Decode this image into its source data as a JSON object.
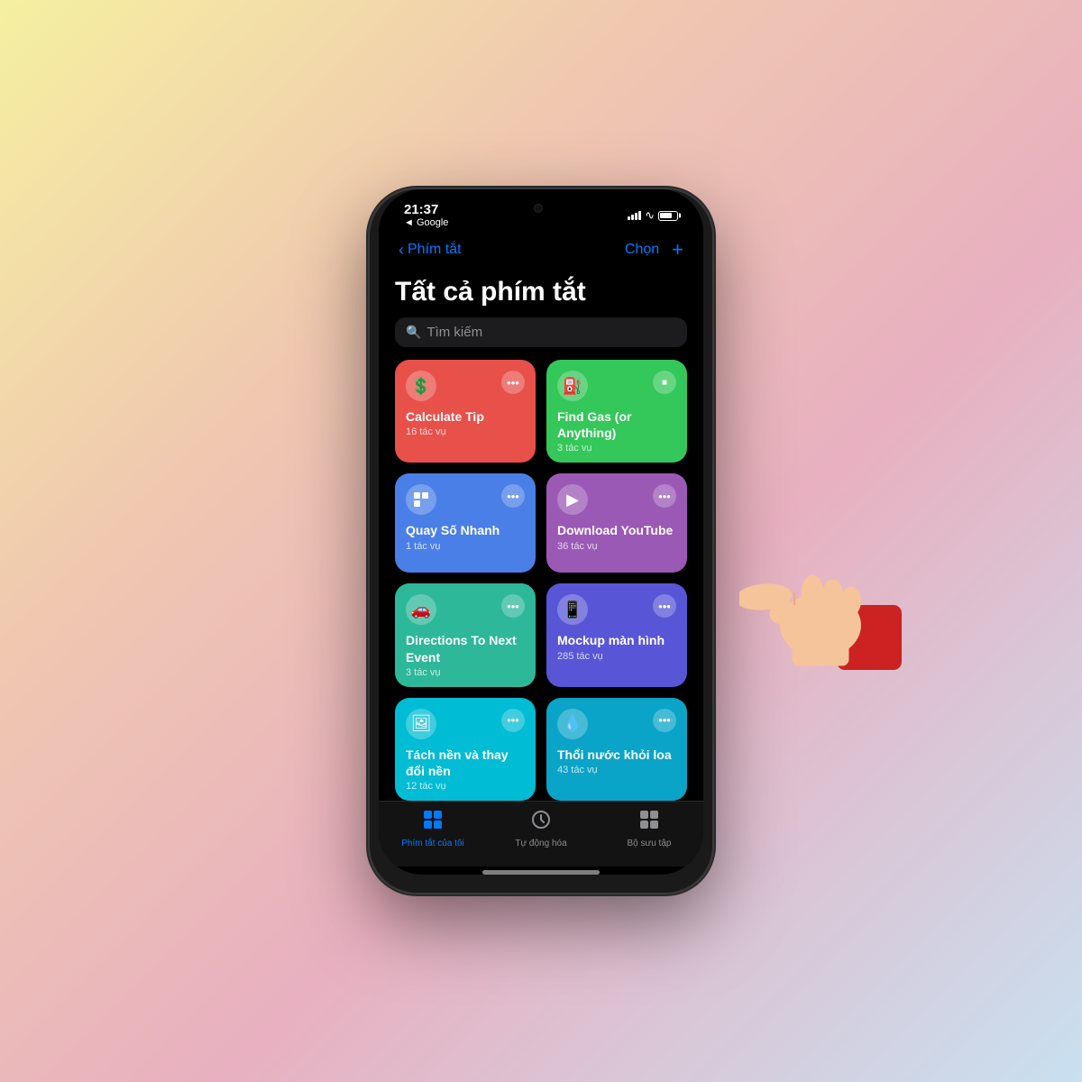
{
  "background": {
    "gradient": "linear-gradient(135deg, #f5f0a0, #f0c8b0, #e8b0c0, #c8e0f0)"
  },
  "status_bar": {
    "time": "21:37",
    "back_label": "◄ Google"
  },
  "nav": {
    "back_text": "Phím tắt",
    "choose_label": "Chọn",
    "add_label": "+"
  },
  "page": {
    "title": "Tất cả phím tắt"
  },
  "search": {
    "placeholder": "Tìm kiếm"
  },
  "shortcuts": [
    {
      "id": "calculate-tip",
      "title": "Calculate Tip",
      "subtitle": "16 tác vụ",
      "icon": "💲",
      "color": "card-red",
      "button_type": "menu"
    },
    {
      "id": "find-gas",
      "title": "Find Gas (or Anything)",
      "subtitle": "3 tác vụ",
      "icon": "⛽",
      "color": "card-green",
      "button_type": "stop"
    },
    {
      "id": "quay-so-nhanh",
      "title": "Quay Số Nhanh",
      "subtitle": "1 tác vụ",
      "icon": "⬡",
      "color": "card-blue",
      "button_type": "menu"
    },
    {
      "id": "download-youtube",
      "title": "Download YouTube",
      "subtitle": "36 tác vụ",
      "icon": "▶",
      "color": "card-purple",
      "button_type": "menu"
    },
    {
      "id": "directions-event",
      "title": "Directions To Next Event",
      "subtitle": "3 tác vụ",
      "icon": "🚗",
      "color": "card-teal",
      "button_type": "menu"
    },
    {
      "id": "mockup-man-hinh",
      "title": "Mockup màn hình",
      "subtitle": "285 tác vụ",
      "icon": "📱",
      "color": "card-indigo",
      "button_type": "menu"
    },
    {
      "id": "tach-nen",
      "title": "Tách nền và thay đổi nền",
      "subtitle": "12 tác vụ",
      "icon": "🖼",
      "color": "card-cyan",
      "button_type": "menu"
    },
    {
      "id": "thoi-nuoc",
      "title": "Thổi nước khỏi loa",
      "subtitle": "43 tác vụ",
      "icon": "💧",
      "color": "card-lightblue",
      "button_type": "menu"
    },
    {
      "id": "wifi-partial",
      "title": "",
      "subtitle": "",
      "icon": "📶",
      "color": "card-teal",
      "button_type": "menu",
      "partial": true
    },
    {
      "id": "sound-partial",
      "title": "",
      "subtitle": "",
      "icon": "📊",
      "color": "card-red",
      "button_type": "menu",
      "partial": true
    }
  ],
  "tabs": [
    {
      "id": "my-shortcuts",
      "label": "Phím tắt của tôi",
      "icon": "⊞",
      "active": true
    },
    {
      "id": "automation",
      "label": "Tự động hóa",
      "icon": "⏰",
      "active": false
    },
    {
      "id": "gallery",
      "label": "Bộ sưu tập",
      "icon": "⬡",
      "active": false
    }
  ]
}
